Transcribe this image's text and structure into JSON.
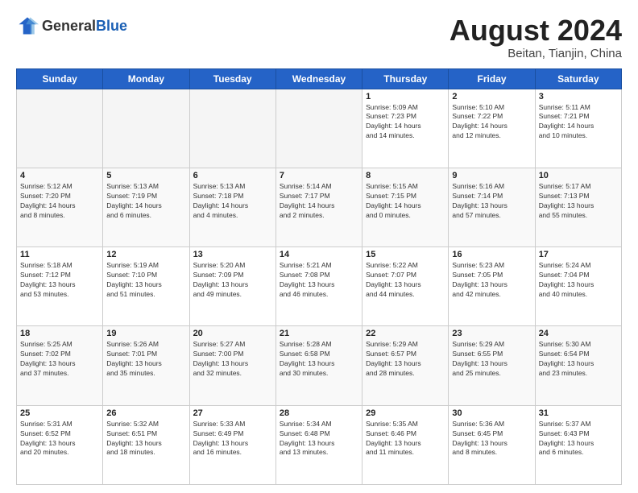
{
  "header": {
    "logo_general": "General",
    "logo_blue": "Blue",
    "month_year": "August 2024",
    "location": "Beitan, Tianjin, China"
  },
  "days_of_week": [
    "Sunday",
    "Monday",
    "Tuesday",
    "Wednesday",
    "Thursday",
    "Friday",
    "Saturday"
  ],
  "weeks": [
    [
      {
        "day": "",
        "info": ""
      },
      {
        "day": "",
        "info": ""
      },
      {
        "day": "",
        "info": ""
      },
      {
        "day": "",
        "info": ""
      },
      {
        "day": "1",
        "info": "Sunrise: 5:09 AM\nSunset: 7:23 PM\nDaylight: 14 hours\nand 14 minutes."
      },
      {
        "day": "2",
        "info": "Sunrise: 5:10 AM\nSunset: 7:22 PM\nDaylight: 14 hours\nand 12 minutes."
      },
      {
        "day": "3",
        "info": "Sunrise: 5:11 AM\nSunset: 7:21 PM\nDaylight: 14 hours\nand 10 minutes."
      }
    ],
    [
      {
        "day": "4",
        "info": "Sunrise: 5:12 AM\nSunset: 7:20 PM\nDaylight: 14 hours\nand 8 minutes."
      },
      {
        "day": "5",
        "info": "Sunrise: 5:13 AM\nSunset: 7:19 PM\nDaylight: 14 hours\nand 6 minutes."
      },
      {
        "day": "6",
        "info": "Sunrise: 5:13 AM\nSunset: 7:18 PM\nDaylight: 14 hours\nand 4 minutes."
      },
      {
        "day": "7",
        "info": "Sunrise: 5:14 AM\nSunset: 7:17 PM\nDaylight: 14 hours\nand 2 minutes."
      },
      {
        "day": "8",
        "info": "Sunrise: 5:15 AM\nSunset: 7:15 PM\nDaylight: 14 hours\nand 0 minutes."
      },
      {
        "day": "9",
        "info": "Sunrise: 5:16 AM\nSunset: 7:14 PM\nDaylight: 13 hours\nand 57 minutes."
      },
      {
        "day": "10",
        "info": "Sunrise: 5:17 AM\nSunset: 7:13 PM\nDaylight: 13 hours\nand 55 minutes."
      }
    ],
    [
      {
        "day": "11",
        "info": "Sunrise: 5:18 AM\nSunset: 7:12 PM\nDaylight: 13 hours\nand 53 minutes."
      },
      {
        "day": "12",
        "info": "Sunrise: 5:19 AM\nSunset: 7:10 PM\nDaylight: 13 hours\nand 51 minutes."
      },
      {
        "day": "13",
        "info": "Sunrise: 5:20 AM\nSunset: 7:09 PM\nDaylight: 13 hours\nand 49 minutes."
      },
      {
        "day": "14",
        "info": "Sunrise: 5:21 AM\nSunset: 7:08 PM\nDaylight: 13 hours\nand 46 minutes."
      },
      {
        "day": "15",
        "info": "Sunrise: 5:22 AM\nSunset: 7:07 PM\nDaylight: 13 hours\nand 44 minutes."
      },
      {
        "day": "16",
        "info": "Sunrise: 5:23 AM\nSunset: 7:05 PM\nDaylight: 13 hours\nand 42 minutes."
      },
      {
        "day": "17",
        "info": "Sunrise: 5:24 AM\nSunset: 7:04 PM\nDaylight: 13 hours\nand 40 minutes."
      }
    ],
    [
      {
        "day": "18",
        "info": "Sunrise: 5:25 AM\nSunset: 7:02 PM\nDaylight: 13 hours\nand 37 minutes."
      },
      {
        "day": "19",
        "info": "Sunrise: 5:26 AM\nSunset: 7:01 PM\nDaylight: 13 hours\nand 35 minutes."
      },
      {
        "day": "20",
        "info": "Sunrise: 5:27 AM\nSunset: 7:00 PM\nDaylight: 13 hours\nand 32 minutes."
      },
      {
        "day": "21",
        "info": "Sunrise: 5:28 AM\nSunset: 6:58 PM\nDaylight: 13 hours\nand 30 minutes."
      },
      {
        "day": "22",
        "info": "Sunrise: 5:29 AM\nSunset: 6:57 PM\nDaylight: 13 hours\nand 28 minutes."
      },
      {
        "day": "23",
        "info": "Sunrise: 5:29 AM\nSunset: 6:55 PM\nDaylight: 13 hours\nand 25 minutes."
      },
      {
        "day": "24",
        "info": "Sunrise: 5:30 AM\nSunset: 6:54 PM\nDaylight: 13 hours\nand 23 minutes."
      }
    ],
    [
      {
        "day": "25",
        "info": "Sunrise: 5:31 AM\nSunset: 6:52 PM\nDaylight: 13 hours\nand 20 minutes."
      },
      {
        "day": "26",
        "info": "Sunrise: 5:32 AM\nSunset: 6:51 PM\nDaylight: 13 hours\nand 18 minutes."
      },
      {
        "day": "27",
        "info": "Sunrise: 5:33 AM\nSunset: 6:49 PM\nDaylight: 13 hours\nand 16 minutes."
      },
      {
        "day": "28",
        "info": "Sunrise: 5:34 AM\nSunset: 6:48 PM\nDaylight: 13 hours\nand 13 minutes."
      },
      {
        "day": "29",
        "info": "Sunrise: 5:35 AM\nSunset: 6:46 PM\nDaylight: 13 hours\nand 11 minutes."
      },
      {
        "day": "30",
        "info": "Sunrise: 5:36 AM\nSunset: 6:45 PM\nDaylight: 13 hours\nand 8 minutes."
      },
      {
        "day": "31",
        "info": "Sunrise: 5:37 AM\nSunset: 6:43 PM\nDaylight: 13 hours\nand 6 minutes."
      }
    ]
  ]
}
